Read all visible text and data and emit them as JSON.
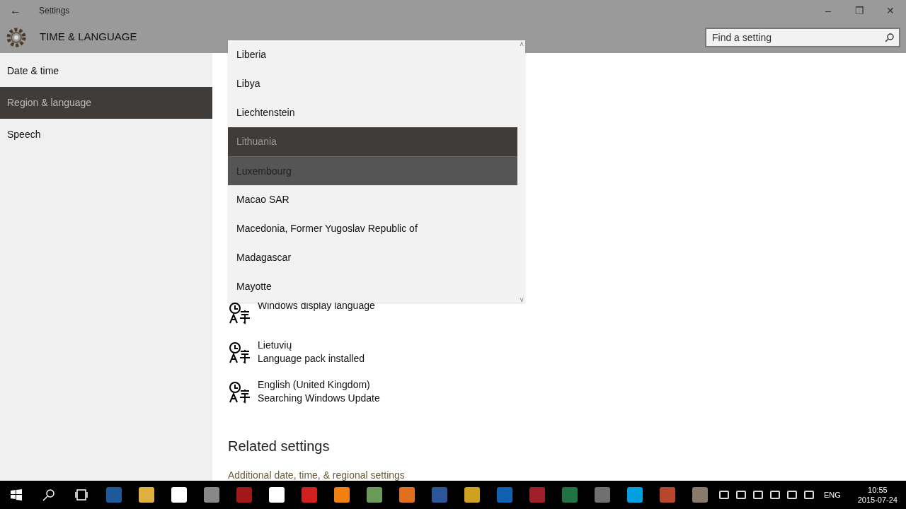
{
  "window": {
    "title": "Settings",
    "back": "←",
    "controls": [
      "–",
      "❐",
      "✕"
    ]
  },
  "header": {
    "title": "TIME & LANGUAGE"
  },
  "search": {
    "placeholder": "Find a setting"
  },
  "sidebar": {
    "items": [
      {
        "label": "Date & time",
        "selected": false
      },
      {
        "label": "Region & language",
        "selected": true
      },
      {
        "label": "Speech",
        "selected": false
      }
    ]
  },
  "country_dropdown": {
    "scroll_up": "˄",
    "scroll_down": "˅",
    "options": [
      {
        "label": "Liberia",
        "selected": false,
        "hovered": false
      },
      {
        "label": "Libya",
        "selected": false,
        "hovered": false
      },
      {
        "label": "Liechtenstein",
        "selected": false,
        "hovered": false
      },
      {
        "label": "Lithuania",
        "selected": true,
        "hovered": false
      },
      {
        "label": "Luxembourg",
        "selected": false,
        "hovered": true
      },
      {
        "label": "Macao SAR",
        "selected": false,
        "hovered": false
      },
      {
        "label": "Macedonia, Former Yugoslav Republic of",
        "selected": false,
        "hovered": false
      },
      {
        "label": "Madagascar",
        "selected": false,
        "hovered": false
      },
      {
        "label": "Mayotte",
        "selected": false,
        "hovered": false
      }
    ]
  },
  "languages": [
    {
      "status": "Windows display language"
    },
    {
      "name": "Lietuvių",
      "status": "Language pack installed"
    },
    {
      "name": "English (United Kingdom)",
      "status": "Searching Windows Update"
    }
  ],
  "related": {
    "heading": "Related settings",
    "link": "Additional date, time, & regional settings"
  },
  "taskbar": {
    "apps": [
      {
        "kind": "start"
      },
      {
        "kind": "search"
      },
      {
        "kind": "taskview"
      },
      {
        "kind": "app",
        "color": "#1e5a9a"
      },
      {
        "kind": "app",
        "color": "#e0b040"
      },
      {
        "kind": "app",
        "color": "#ffffff"
      },
      {
        "kind": "app",
        "color": "#888888"
      },
      {
        "kind": "app",
        "color": "#a01818"
      },
      {
        "kind": "app",
        "color": "#ffffff"
      },
      {
        "kind": "app",
        "color": "#d02020"
      },
      {
        "kind": "app",
        "color": "#f08010"
      },
      {
        "kind": "app",
        "color": "#6a9a5a"
      },
      {
        "kind": "app",
        "color": "#e07020"
      },
      {
        "kind": "app",
        "color": "#2b579a"
      },
      {
        "kind": "app",
        "color": "#d0a020"
      },
      {
        "kind": "app",
        "color": "#1060b0"
      },
      {
        "kind": "app",
        "color": "#a0202a"
      },
      {
        "kind": "app",
        "color": "#217346"
      },
      {
        "kind": "app",
        "color": "#707070"
      },
      {
        "kind": "app",
        "color": "#00a0e0"
      },
      {
        "kind": "app",
        "color": "#b7472a"
      },
      {
        "kind": "app",
        "color": "#8a7a6a"
      }
    ],
    "tray": {
      "language": "ENG",
      "time": "10:55",
      "date": "2015-07-24"
    }
  }
}
